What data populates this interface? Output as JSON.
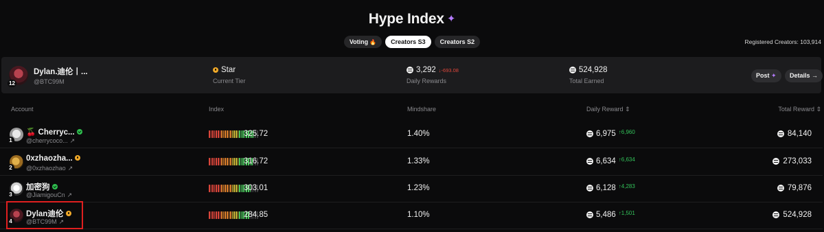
{
  "header": {
    "title": "Hype Index",
    "sparkle_icon": "sparkle-icon",
    "registered_label": "Registered Creators: 103,914"
  },
  "tabs": [
    {
      "label": "Voting",
      "icon": "fire-icon",
      "active": false
    },
    {
      "label": "Creators S3",
      "active": true
    },
    {
      "label": "Creators S2",
      "active": false
    }
  ],
  "profile": {
    "name": "Dylan.迪伦丨...",
    "handle": "@BTC99M",
    "rank": "12",
    "tier_value": "Star",
    "tier_label": "Current Tier",
    "daily_rewards": "3,292",
    "daily_delta": "-693.08",
    "daily_label": "Daily Rewards",
    "total_earned": "524,928",
    "total_label": "Total Earned",
    "post_label": "Post",
    "details_label": "Details →"
  },
  "table": {
    "columns": {
      "account": "Account",
      "index": "Index",
      "mindshare": "Mindshare",
      "daily_reward": "Daily Reward ⇕",
      "total_reward": "Total Reward ⇕"
    },
    "rows": [
      {
        "rank": "1",
        "name": "🍒 Cherryc...",
        "badge": "green",
        "handle": "@cherrycoco...",
        "index": "325.72",
        "index_level": 0.92,
        "mindshare": "1.40%",
        "daily": "6,975",
        "daily_delta": "↑6,960",
        "total": "84,140"
      },
      {
        "rank": "2",
        "name": "0xzhaozha...",
        "badge": "gold",
        "handle": "@0xzhaozhao",
        "index": "316.72",
        "index_level": 0.89,
        "mindshare": "1.33%",
        "daily": "6,634",
        "daily_delta": "↑6,634",
        "total": "273,033"
      },
      {
        "rank": "3",
        "name": "加密狗",
        "badge": "green",
        "handle": "@JiamigouCn",
        "index": "303.01",
        "index_level": 0.86,
        "mindshare": "1.23%",
        "daily": "6,128",
        "daily_delta": "↑4,283",
        "total": "79,876"
      },
      {
        "rank": "4",
        "name": "Dylan迪伦",
        "badge": "gold",
        "handle": "@BTC99M",
        "index": "284.85",
        "index_level": 0.82,
        "mindshare": "1.10%",
        "daily": "5,486",
        "daily_delta": "↑1,501",
        "total": "524,928"
      }
    ]
  }
}
